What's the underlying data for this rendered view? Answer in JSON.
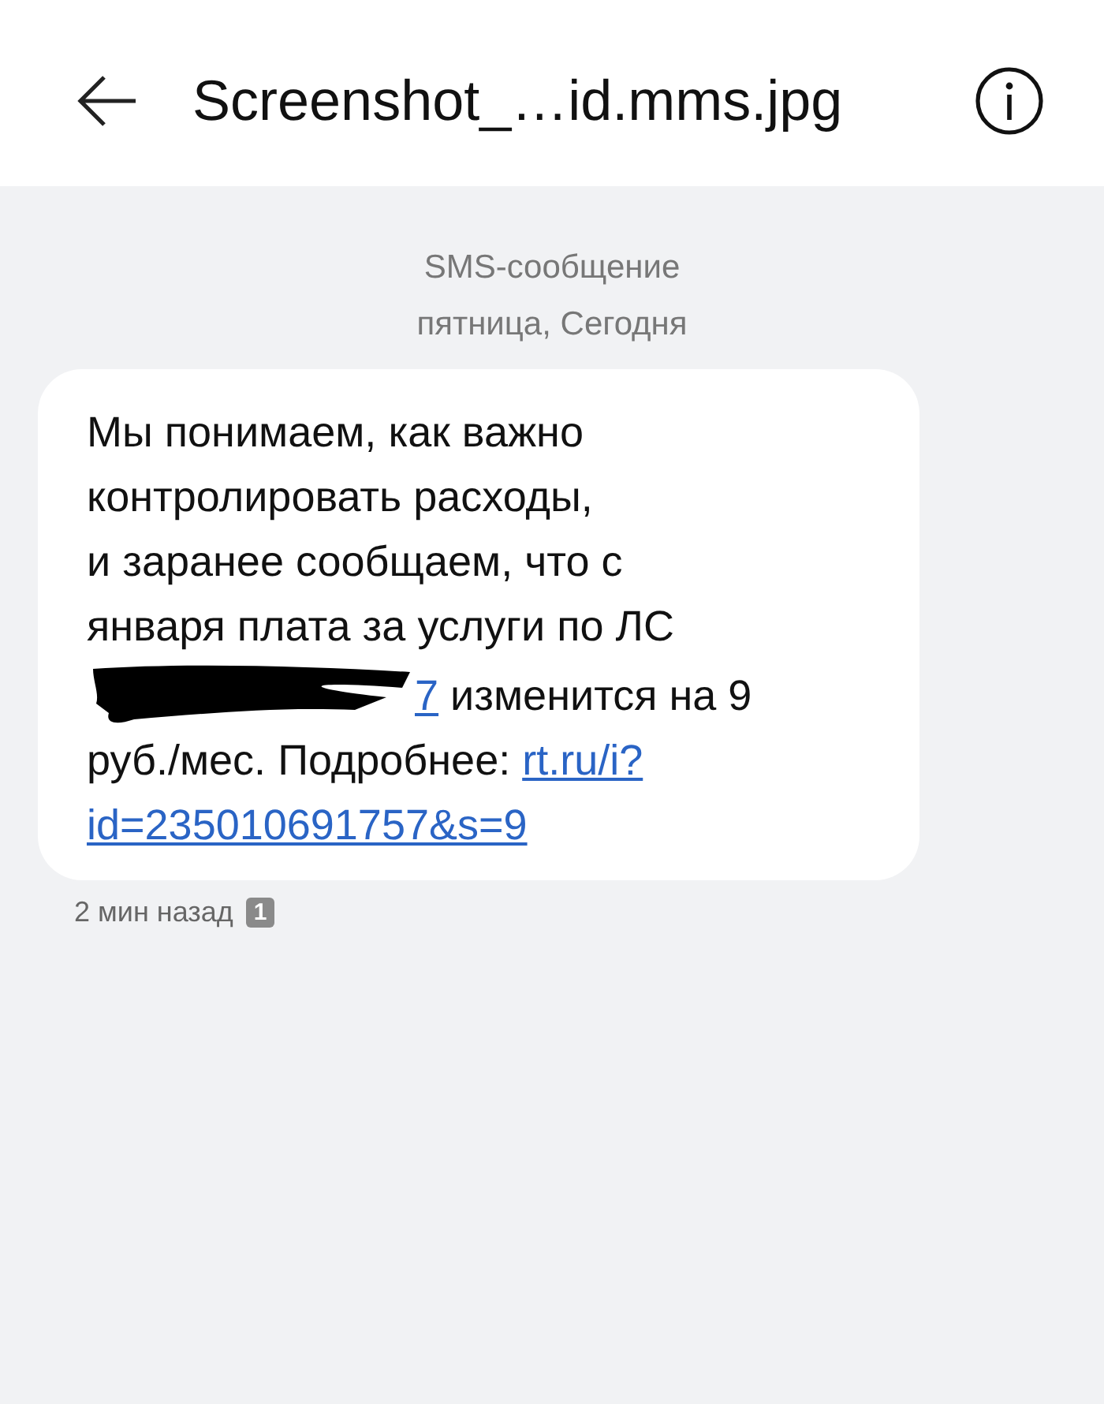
{
  "header": {
    "title": "Screenshot_…id.mms.jpg"
  },
  "conversation": {
    "type_label": "SMS-сообщение",
    "date_label": "пятница, Сегодня"
  },
  "message": {
    "segments": [
      {
        "kind": "text",
        "text": "Мы понимаем, как важно\nконтролировать расходы,\nи заранее сообщаем, что с\nянваря плата за услуги по ЛС\n"
      },
      {
        "kind": "redaction"
      },
      {
        "kind": "link",
        "text": "7"
      },
      {
        "kind": "text",
        "text": " изменится на 9\nруб./мес. Подробнее: "
      },
      {
        "kind": "link",
        "text": "rt.ru/i?"
      },
      {
        "kind": "break"
      },
      {
        "kind": "link",
        "text": "id=235010691757&s=9"
      }
    ],
    "time": "2 мин назад",
    "sim": "1"
  }
}
